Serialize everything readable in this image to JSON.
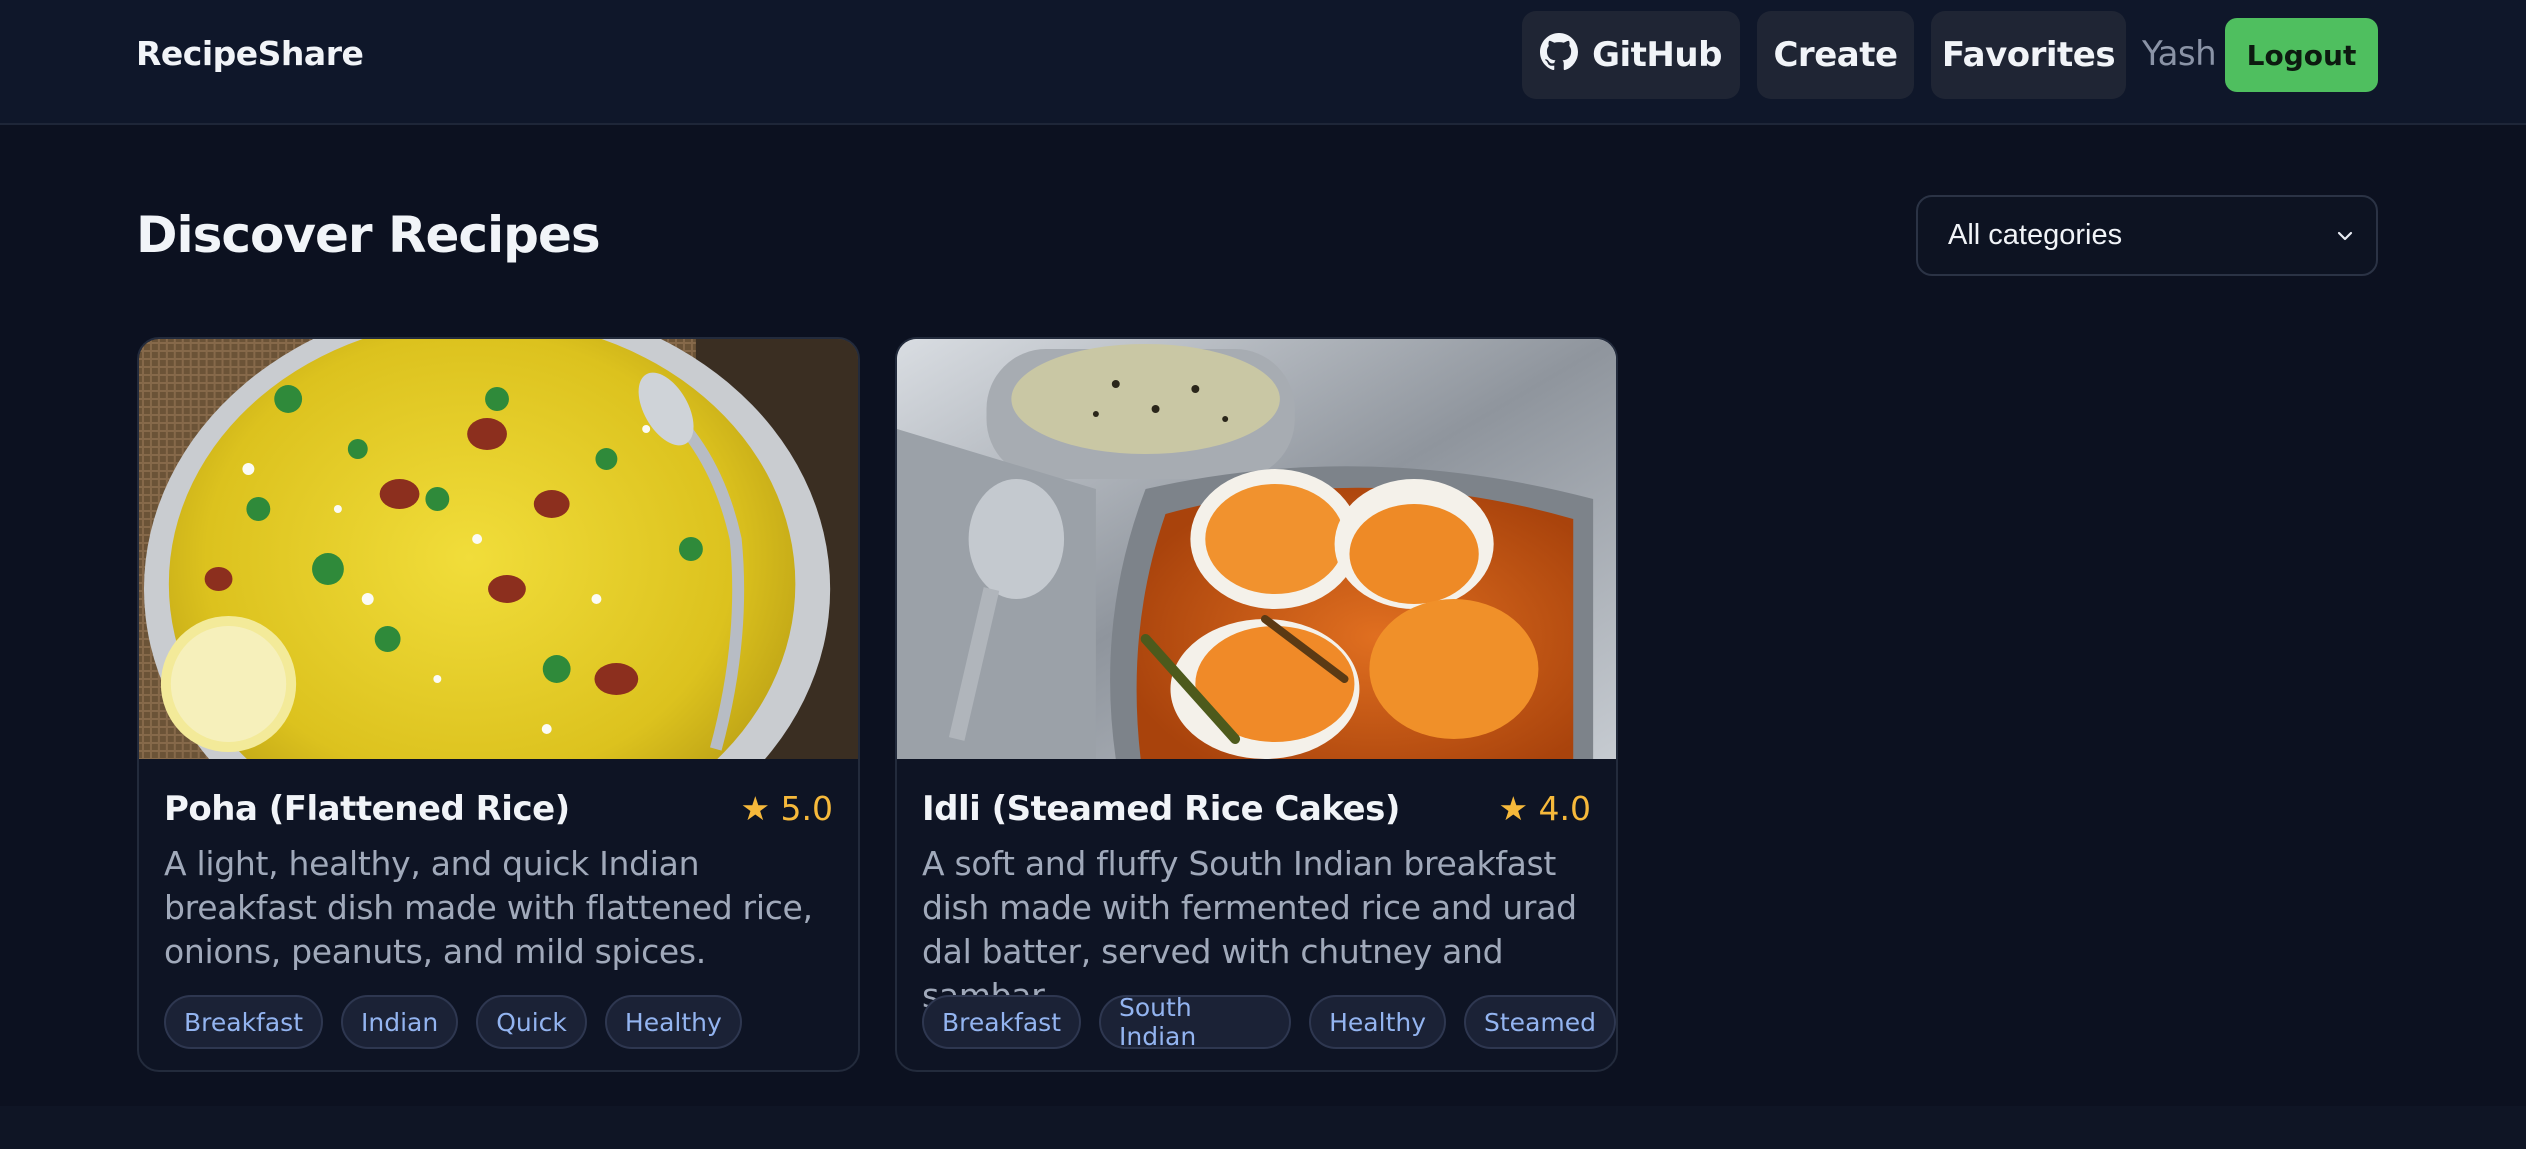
{
  "header": {
    "brand": "RecipeShare",
    "github_label": "GitHub",
    "create_label": "Create",
    "favorites_label": "Favorites",
    "username": "Yash",
    "logout_label": "Logout"
  },
  "main": {
    "title": "Discover Recipes",
    "category_filter": {
      "selected": "All categories"
    }
  },
  "recipes": [
    {
      "title": "Poha (Flattened Rice)",
      "rating": "★ 5.0",
      "description": "A light, healthy, and quick Indian breakfast dish made with flattened rice, onions, peanuts, and mild spices.",
      "tags": [
        "Breakfast",
        "Indian",
        "Quick",
        "Healthy"
      ],
      "image": "poha-bowl-photo"
    },
    {
      "title": "Idli (Steamed Rice Cakes)",
      "rating": "★ 4.0",
      "description": "A soft and fluffy South Indian breakfast dish made with fermented rice and urad dal batter, served with chutney and sambar.",
      "tags": [
        "Breakfast",
        "South Indian",
        "Healthy",
        "Steamed"
      ],
      "image": "idli-thali-photo"
    }
  ],
  "colors": {
    "background": "#0c1120",
    "header": "#0f172a",
    "logout_green": "#4fbf5f",
    "rating_gold": "#f6b93b",
    "tag_text": "#93b4f0"
  }
}
